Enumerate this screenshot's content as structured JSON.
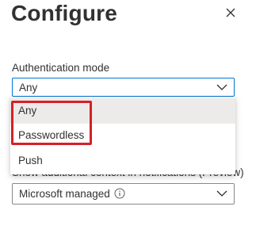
{
  "panel": {
    "title": "Configure",
    "close_icon": "close-icon"
  },
  "authentication": {
    "label": "Authentication mode",
    "selected": "Any",
    "options": [
      "Any",
      "Passwordless",
      "Push"
    ]
  },
  "context": {
    "label": "Show additional context in notifications (Preview)",
    "selected": "Microsoft managed",
    "info_icon": "info-icon"
  },
  "colors": {
    "accent": "#0078d4",
    "highlight": "#d61f26",
    "selected_bg": "#edebe9"
  }
}
